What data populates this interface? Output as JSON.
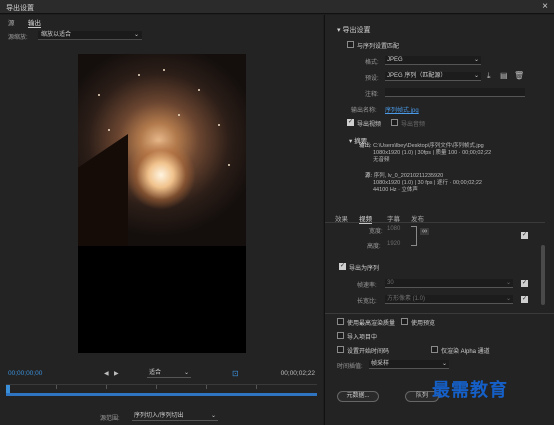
{
  "window": {
    "title": "导出设置",
    "close": "×"
  },
  "left": {
    "tabs": [
      "源",
      "输出"
    ],
    "scale_label": "源缩放:",
    "scale_value": "缩放以适合",
    "timecode_left": "00;00;00;00",
    "timecode_right": "00;00;02;22",
    "fit_value": "适合",
    "range_label": "源范围:",
    "range_value": "序列切入/序列切出"
  },
  "right": {
    "export_settings": "导出设置",
    "match_sequence": "与序列设置匹配",
    "format_label": "格式:",
    "format_value": "JPEG",
    "preset_label": "预设:",
    "preset_value": "JPEG 序列（匹配源）",
    "comment_label": "注释:",
    "output_name_label": "输出名称:",
    "output_name_value": "序列帧式.jpg",
    "export_video": "导出视频",
    "export_audio": "导出音频",
    "summary_head": "摘要",
    "summary_output_key": "输出:",
    "summary_output_path": "C:\\Users\\lbey\\Desktop\\序列文件\\序列帧式.jpg",
    "summary_output_l2": "1080x1920 (1.0) | 30fps | 质量 100 · 00;00;02;22",
    "summary_output_l3": "无音频",
    "summary_source_key": "源:",
    "summary_source_name": "序列, lv_0_20210211235920",
    "summary_source_l2": "1080x1920 (1.0) | 30 fps | 逐行 · 00;00;02;22",
    "summary_source_l3": "44100 Hz · 立体声",
    "tabs": [
      "效果",
      "视频",
      "字幕",
      "发布"
    ],
    "width_label": "宽度:",
    "width_value": "1080",
    "height_label": "高度:",
    "height_value": "1920",
    "export_as_sequence": "导出为序列",
    "framerate_label": "帧速率:",
    "framerate_value": "30",
    "aspect_label": "长宽比:",
    "aspect_value": "方形像素 (1.0)",
    "max_render": "使用最高渲染质量",
    "use_preview": "使用预览",
    "import_project": "导入项目中",
    "set_timecode": "设置开始时间码",
    "alpha_only": "仅渲染 Alpha 通道",
    "interp_label": "时间插值:",
    "interp_value": "帧采样",
    "metadata_btn": "元数据...",
    "queue_btn": "队列"
  },
  "watermark": "最需教育"
}
